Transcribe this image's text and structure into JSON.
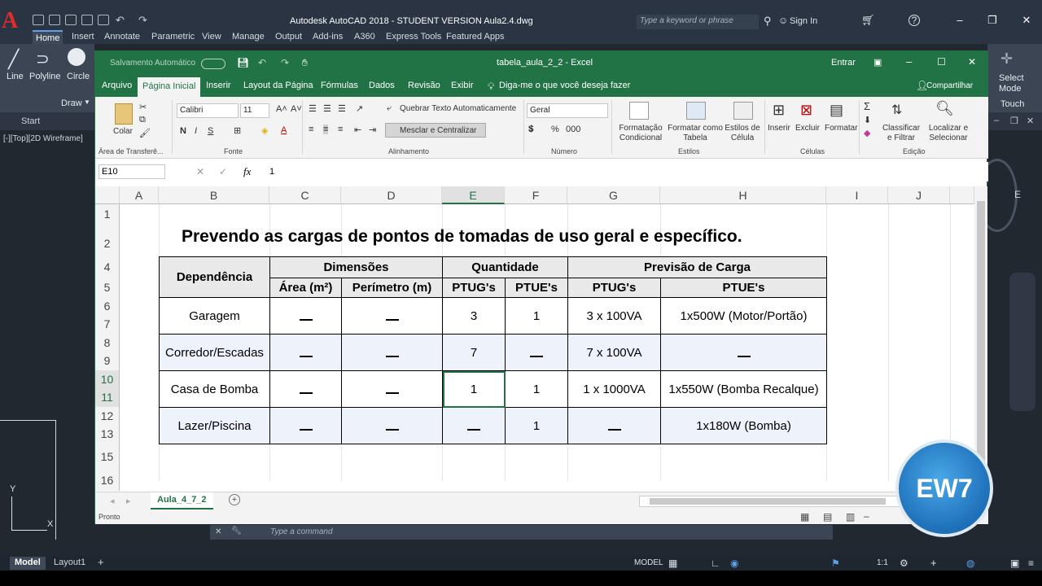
{
  "acad": {
    "logo": "A",
    "title": "Autodesk AutoCAD 2018 - STUDENT VERSION    Aula2.4.dwg",
    "search_placeholder": "Type a keyword or phrase",
    "sign_in": "Sign In",
    "tabs": [
      "Home",
      "Insert",
      "Annotate",
      "Parametric",
      "View",
      "Manage",
      "Output",
      "Add-ins",
      "A360",
      "Express Tools",
      "Featured Apps"
    ],
    "tools": {
      "line": "Line",
      "polyline": "Polyline",
      "circle": "Circle",
      "draw": "Draw"
    },
    "right_tools": {
      "select_mode": "Select Mode",
      "touch": "Touch"
    },
    "start_tab": "Start",
    "view_label": "[-][Top][2D Wireframe]",
    "command_placeholder": "Type a command",
    "layout_tabs": [
      "Model",
      "Layout1"
    ],
    "status": {
      "model": "MODEL",
      "scale": "1:1"
    }
  },
  "excel": {
    "autosave": "Salvamento Automático",
    "title": "tabela_aula_2_2  -  Excel",
    "signin": "Entrar",
    "menu": [
      "Arquivo",
      "Página Inicial",
      "Inserir",
      "Layout da Página",
      "Fórmulas",
      "Dados",
      "Revisão",
      "Exibir"
    ],
    "tell_me": "Diga-me o que você deseja fazer",
    "share": "Compartilhar",
    "ribbon": {
      "paste": "Colar",
      "clipboard": "Área de Transferê...",
      "font_name": "Calibri",
      "font_size": "11",
      "font_group": "Fonte",
      "wrap": "Quebrar Texto Automaticamente",
      "merge": "Mesclar e Centralizar",
      "align_group": "Alinhamento",
      "number_format": "Geral",
      "number_group": "Número",
      "cond_format": "Formatação Condicional",
      "format_table": "Formatar como Tabela",
      "cell_styles": "Estilos de Célula",
      "styles_group": "Estilos",
      "insert": "Inserir",
      "delete": "Excluir",
      "format": "Formatar",
      "cells_group": "Células",
      "sort": "Classificar e Filtrar",
      "find": "Localizar e Selecionar",
      "edit_group": "Edição"
    },
    "namebox": "E10",
    "formula": "1",
    "columns": [
      "A",
      "B",
      "C",
      "D",
      "E",
      "F",
      "G",
      "H",
      "I",
      "J"
    ],
    "rows": [
      "1",
      "2",
      "4",
      "5",
      "6",
      "7",
      "8",
      "9",
      "10",
      "11",
      "12",
      "13",
      "15",
      "16"
    ],
    "sheet_title": "Prevendo as cargas de pontos de tomadas de uso geral e específico.",
    "table": {
      "h_dependencia": "Dependência",
      "h_dimensoes": "Dimensões",
      "h_quantidade": "Quantidade",
      "h_previsao": "Previsão  de  Carga",
      "h_area": "Área (m²)",
      "h_perimetro": "Perímetro (m)",
      "h_ptug": "PTUG's",
      "h_ptue": "PTUE's",
      "h_ptug2": "PTUG's",
      "h_ptue2": "PTUE's",
      "rows": [
        {
          "dep": "Garagem",
          "ptug": "3",
          "ptue": "1",
          "carga_ptug": "3 x 100VA",
          "carga_ptue": "1x500W (Motor/Portão)"
        },
        {
          "dep": "Corredor/Escadas",
          "ptug": "7",
          "ptue": "",
          "carga_ptug": "7 x 100VA",
          "carga_ptue": ""
        },
        {
          "dep": "Casa de Bomba",
          "ptug": "1",
          "ptue": "1",
          "carga_ptug": "1 x 1000VA",
          "carga_ptue": "1x550W (Bomba Recalque)"
        },
        {
          "dep": "Lazer/Piscina",
          "ptug": "",
          "ptue": "1",
          "carga_ptug": "",
          "carga_ptue": "1x180W (Bomba)"
        }
      ]
    },
    "sheet_tab": "Aula_4_7_2",
    "status": "Pronto"
  },
  "watermark": "EW7"
}
